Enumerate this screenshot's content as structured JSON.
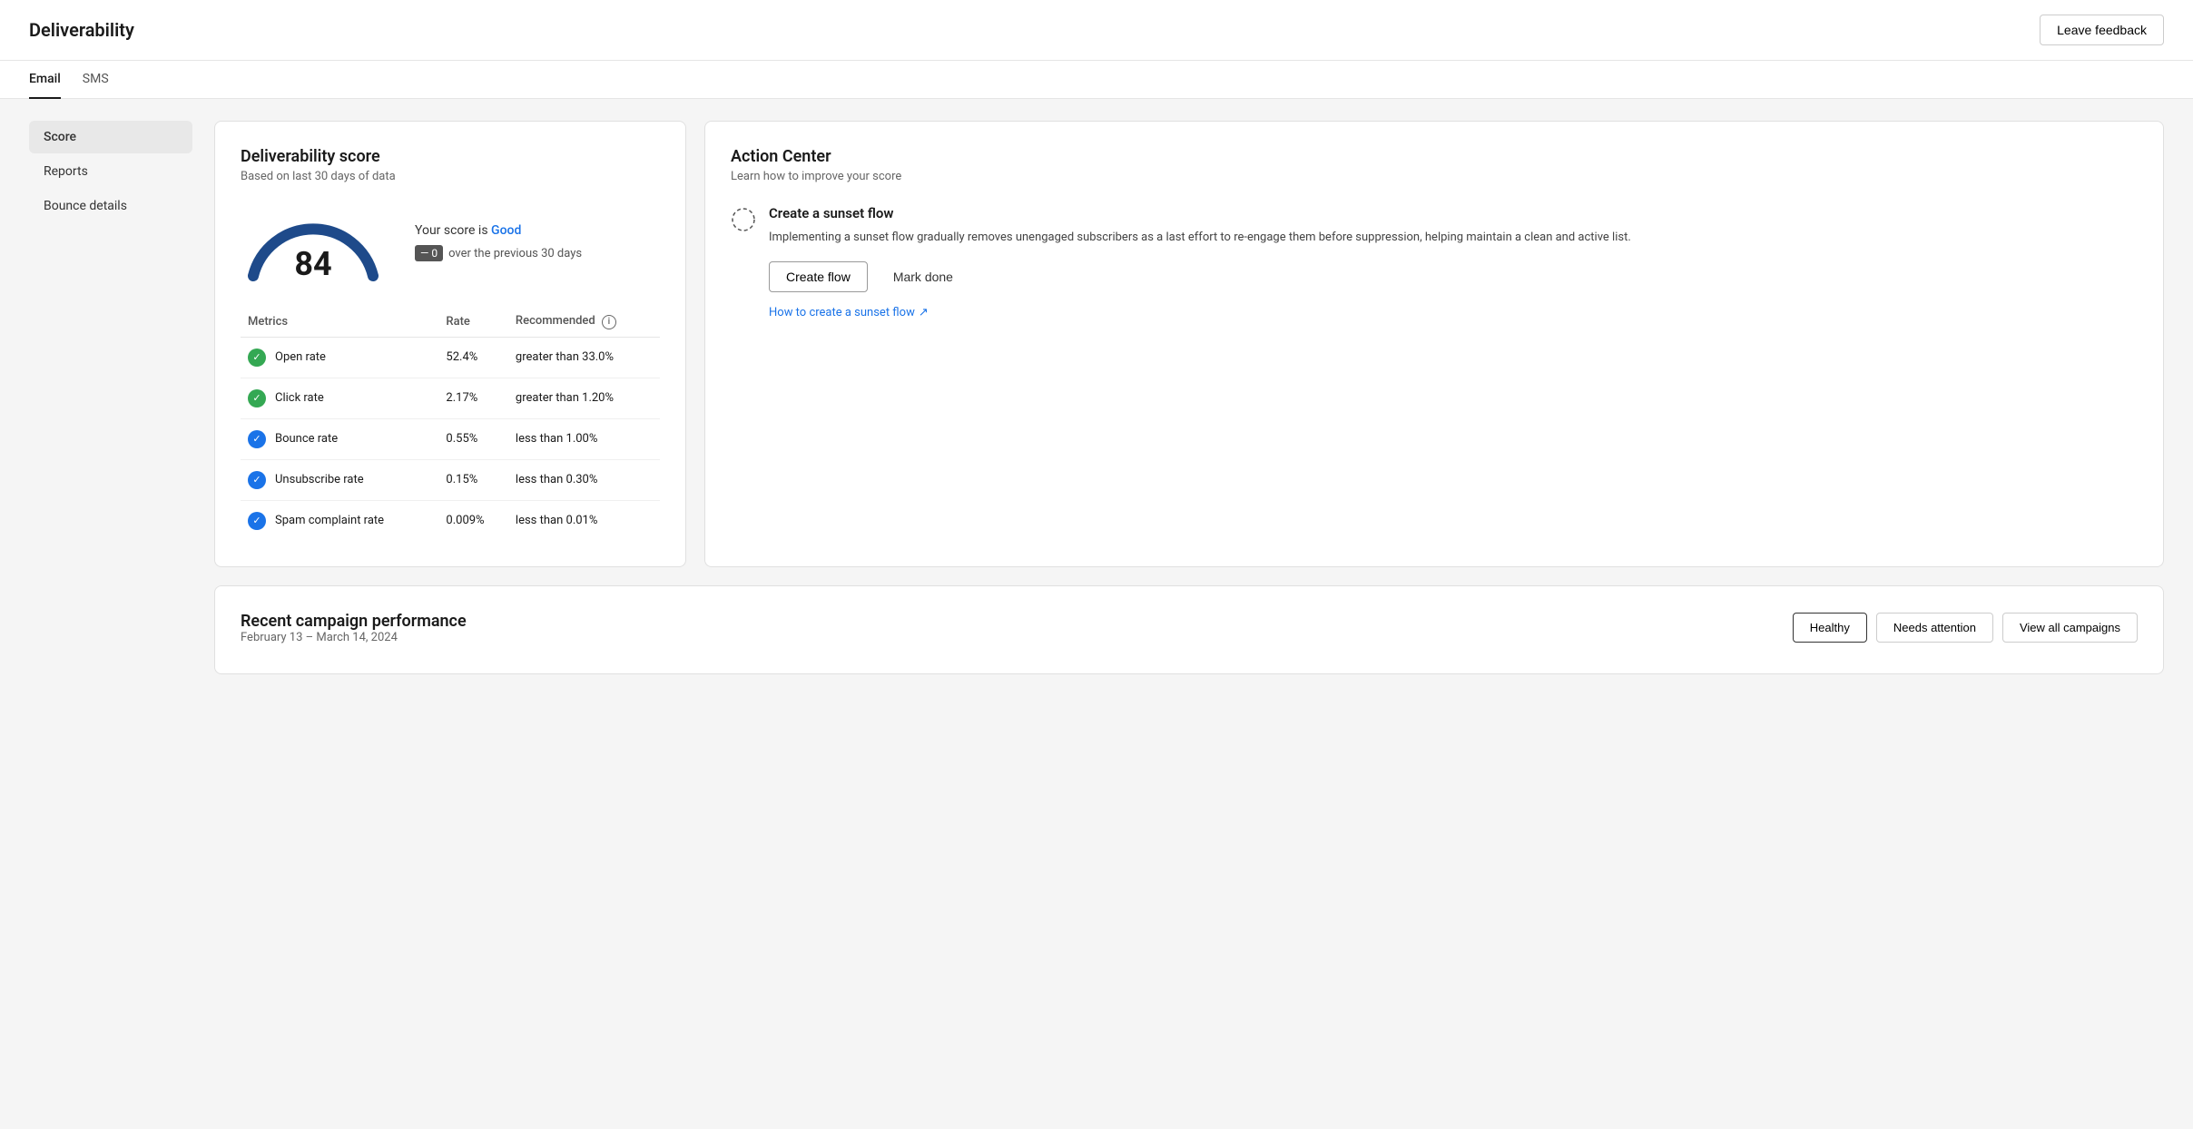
{
  "header": {
    "title": "Deliverability",
    "leave_feedback_label": "Leave feedback"
  },
  "tabs": [
    {
      "label": "Email",
      "active": true
    },
    {
      "label": "SMS",
      "active": false
    }
  ],
  "sidebar": {
    "items": [
      {
        "label": "Score",
        "active": true
      },
      {
        "label": "Reports",
        "active": false
      },
      {
        "label": "Bounce details",
        "active": false
      }
    ]
  },
  "score_card": {
    "title": "Deliverability score",
    "subtitle": "Based on last 30 days of data",
    "score": "84",
    "score_label": "Your score is",
    "score_quality": "Good",
    "score_change": "0",
    "score_change_label": "over the previous 30 days",
    "metrics": {
      "header_metric": "Metrics",
      "header_rate": "Rate",
      "header_recommended": "Recommended",
      "rows": [
        {
          "name": "Open rate",
          "rate": "52.4%",
          "recommended": "greater than 33.0%",
          "status": "green"
        },
        {
          "name": "Click rate",
          "rate": "2.17%",
          "recommended": "greater than 1.20%",
          "status": "green"
        },
        {
          "name": "Bounce rate",
          "rate": "0.55%",
          "recommended": "less than 1.00%",
          "status": "blue"
        },
        {
          "name": "Unsubscribe rate",
          "rate": "0.15%",
          "recommended": "less than 0.30%",
          "status": "blue"
        },
        {
          "name": "Spam complaint rate",
          "rate": "0.009%",
          "recommended": "less than 0.01%",
          "status": "blue"
        }
      ]
    }
  },
  "action_card": {
    "title": "Action Center",
    "subtitle": "Learn how to improve your score",
    "action_title": "Create a sunset flow",
    "action_desc": "Implementing a sunset flow gradually removes unengaged subscribers as a last effort to re-engage them before suppression, helping maintain a clean and active list.",
    "create_flow_label": "Create flow",
    "mark_done_label": "Mark done",
    "link_label": "How to create a sunset flow"
  },
  "campaign_card": {
    "title": "Recent campaign performance",
    "subtitle": "February 13 – March 14, 2024",
    "healthy_label": "Healthy",
    "needs_attention_label": "Needs attention",
    "view_all_label": "View all campaigns"
  },
  "colors": {
    "accent_blue": "#1a73e8",
    "gauge_blue": "#1e4a8a",
    "gauge_light": "#c7d9f5",
    "green": "#34a853"
  }
}
